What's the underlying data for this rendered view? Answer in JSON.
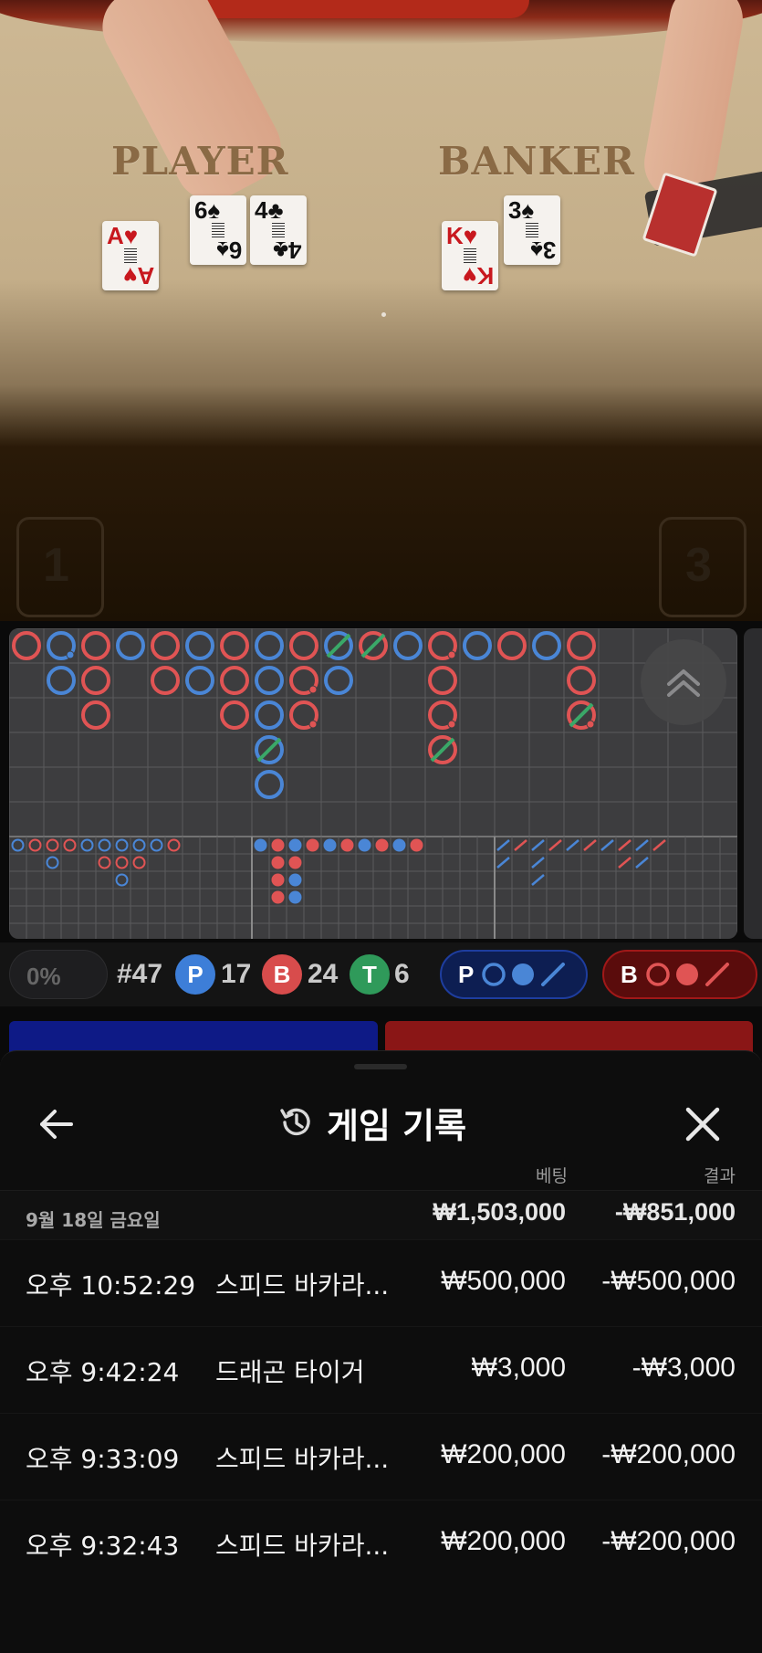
{
  "table": {
    "player_label": "PLAYER",
    "banker_label": "BANKER",
    "player_cards": [
      {
        "rank": "A",
        "suit": "♥",
        "color": "red"
      },
      {
        "rank": "6",
        "suit": "♠",
        "color": "black"
      },
      {
        "rank": "4",
        "suit": "♣",
        "color": "black"
      }
    ],
    "banker_cards": [
      {
        "rank": "K",
        "suit": "♥",
        "color": "red"
      },
      {
        "rank": "3",
        "suit": "♠",
        "color": "black"
      }
    ],
    "left_corner_number": "1",
    "right_corner_number": "3"
  },
  "roadmap": {
    "colors": {
      "player": "#4a86d6",
      "banker": "#e05454",
      "tie": "#3aa868",
      "grid": "#5a5a5c",
      "bg": "#3d3d3f"
    },
    "big_road": [
      [
        "B"
      ],
      [
        "P|pb",
        "P"
      ],
      [
        "B",
        "B",
        "B"
      ],
      [
        "P"
      ],
      [
        "B",
        "B"
      ],
      [
        "P",
        "P"
      ],
      [
        "B",
        "B",
        "B"
      ],
      [
        "P",
        "P",
        "P",
        "P|t",
        "P"
      ],
      [
        "B",
        "B|pb",
        "B|pb"
      ],
      [
        "P|t",
        "P"
      ],
      [
        "B|t"
      ],
      [
        "P"
      ],
      [
        "B|pb",
        "B",
        "B|pb",
        "B|t"
      ],
      [
        "P"
      ],
      [
        "B"
      ],
      [
        "P"
      ],
      [
        "B",
        "B",
        "B|t|pb"
      ]
    ],
    "bead_road_small": [
      [
        "P"
      ],
      [
        "B"
      ],
      [
        "B",
        "P"
      ],
      [
        "B"
      ],
      [
        "P"
      ],
      [
        "P",
        "B"
      ],
      [
        "P",
        "B",
        "P"
      ],
      [
        "P",
        "B"
      ],
      [
        "P"
      ],
      [
        "B"
      ]
    ],
    "dot_road": [
      [
        "P"
      ],
      [
        "B",
        "B",
        "B",
        "B"
      ],
      [
        "P",
        "B",
        "P",
        "P"
      ],
      [
        "B"
      ],
      [
        "P"
      ],
      [
        "B"
      ],
      [
        "P"
      ],
      [
        "B"
      ],
      [
        "P"
      ],
      [
        "B"
      ]
    ],
    "slash_road": [
      [
        "P",
        "P"
      ],
      [
        "B"
      ],
      [
        "P",
        "P",
        "P"
      ],
      [
        "B"
      ],
      [
        "P"
      ],
      [
        "B"
      ],
      [
        "P"
      ],
      [
        "B",
        "B"
      ],
      [
        "P",
        "P"
      ],
      [
        "B"
      ]
    ]
  },
  "stats": {
    "percent": "0%",
    "round": "#47",
    "player_letter": "P",
    "player_count": "17",
    "banker_letter": "B",
    "banker_count": "24",
    "tie_letter": "T",
    "tie_count": "6",
    "player_predict_letter": "P",
    "banker_predict_letter": "B"
  },
  "history": {
    "title": "게임 기록",
    "col_bet": "베팅",
    "col_result": "결과",
    "date": "9월 18일 금요일",
    "date_bet_total": "₩1,503,000",
    "date_result_total": "-₩851,000",
    "rows": [
      {
        "time": "오후 10:52:29",
        "game": "스피드 바카라...",
        "bet": "₩500,000",
        "result": "-₩500,000"
      },
      {
        "time": "오후 9:42:24",
        "game": "드래곤 타이거",
        "bet": "₩3,000",
        "result": "-₩3,000"
      },
      {
        "time": "오후 9:33:09",
        "game": "스피드 바카라...",
        "bet": "₩200,000",
        "result": "-₩200,000"
      },
      {
        "time": "오후 9:32:43",
        "game": "스피드 바카라...",
        "bet": "₩200,000",
        "result": "-₩200,000"
      }
    ]
  },
  "icons": {
    "back": "arrow-left-icon",
    "history": "history-clock-icon",
    "close": "close-icon",
    "collapse": "chevron-double-up-icon"
  }
}
